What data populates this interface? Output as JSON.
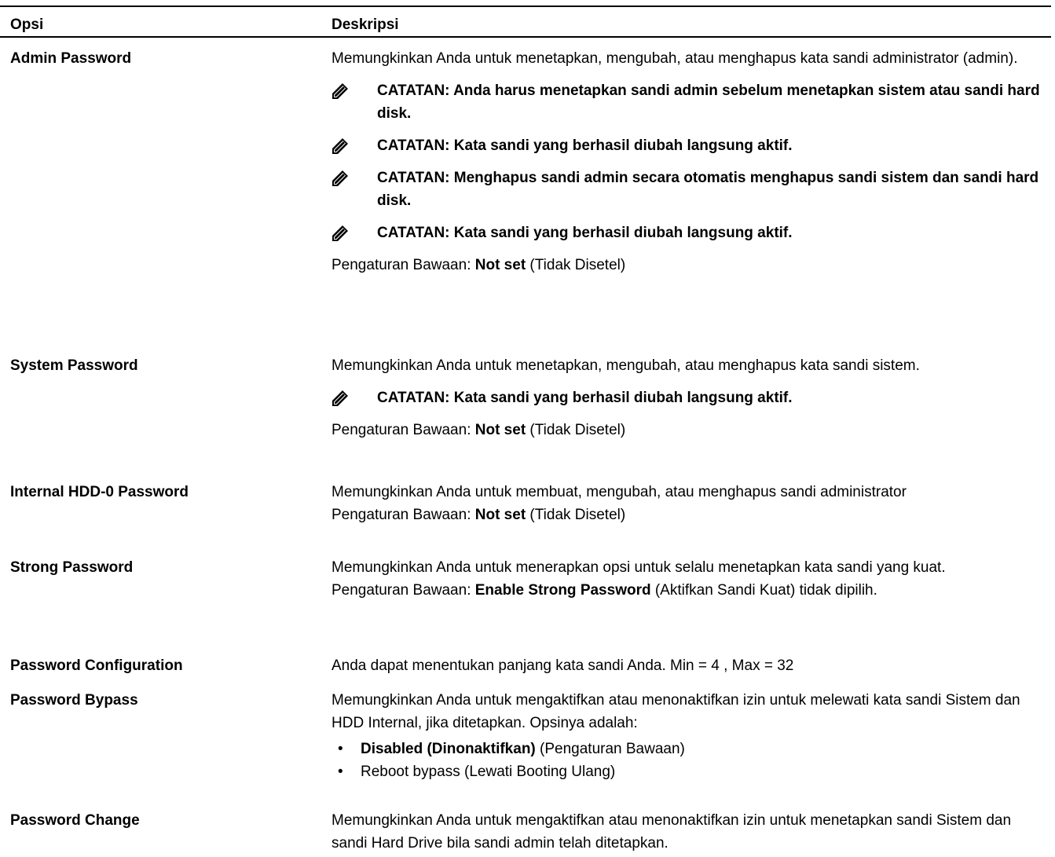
{
  "header": {
    "option": "Opsi",
    "description": "Deskripsi"
  },
  "rows": [
    {
      "option": "Admin Password",
      "description": "Memungkinkan Anda untuk menetapkan, mengubah, atau menghapus kata sandi administrator (admin).",
      "notes": [
        "CATATAN: Anda harus menetapkan sandi admin sebelum menetapkan sistem atau sandi hard disk.",
        "CATATAN: Kata sandi yang berhasil diubah langsung aktif.",
        "CATATAN: Menghapus sandi admin secara otomatis menghapus sandi sistem dan sandi hard disk.",
        "CATATAN: Kata sandi yang berhasil diubah langsung aktif."
      ],
      "default_prefix": "Pengaturan Bawaan: ",
      "default_value": "Not set",
      "default_suffix": " (Tidak Disetel)"
    },
    {
      "option": "System Password",
      "description": "Memungkinkan Anda untuk menetapkan, mengubah, atau menghapus kata sandi sistem.",
      "notes": [
        "CATATAN: Kata sandi yang berhasil diubah langsung aktif."
      ],
      "default_prefix": "Pengaturan Bawaan: ",
      "default_value": "Not set",
      "default_suffix": " (Tidak Disetel)"
    },
    {
      "option": "Internal HDD-0 Password",
      "description": "Memungkinkan Anda untuk membuat, mengubah, atau menghapus sandi administrator",
      "default_prefix": "Pengaturan Bawaan: ",
      "default_value": "Not set",
      "default_suffix": " (Tidak Disetel)"
    },
    {
      "option": "Strong Password",
      "description": "Memungkinkan Anda untuk menerapkan opsi untuk selalu menetapkan kata sandi yang kuat.",
      "default_prefix": "Pengaturan Bawaan: ",
      "default_value": "Enable Strong Password",
      "default_suffix": " (Aktifkan Sandi Kuat) tidak dipilih."
    },
    {
      "option": "Password Configuration",
      "description": "Anda dapat menentukan panjang kata sandi Anda. Min = 4 , Max = 32"
    },
    {
      "option": "Password Bypass",
      "description": "Memungkinkan Anda untuk mengaktifkan atau menonaktifkan izin untuk melewati kata sandi Sistem dan HDD Internal, jika ditetapkan. Opsinya adalah:",
      "bullets": [
        {
          "bold": "Disabled (Dinonaktifkan)",
          "rest": " (Pengaturan Bawaan)"
        },
        {
          "bold": "",
          "rest": "Reboot bypass (Lewati Booting Ulang)"
        }
      ]
    },
    {
      "option": "Password Change",
      "description": "Memungkinkan Anda untuk mengaktifkan atau menonaktifkan izin untuk menetapkan sandi Sistem dan sandi Hard Drive bila sandi admin telah ditetapkan."
    }
  ],
  "bullet_glyph": "•",
  "note_icon": "pencil-note-icon"
}
